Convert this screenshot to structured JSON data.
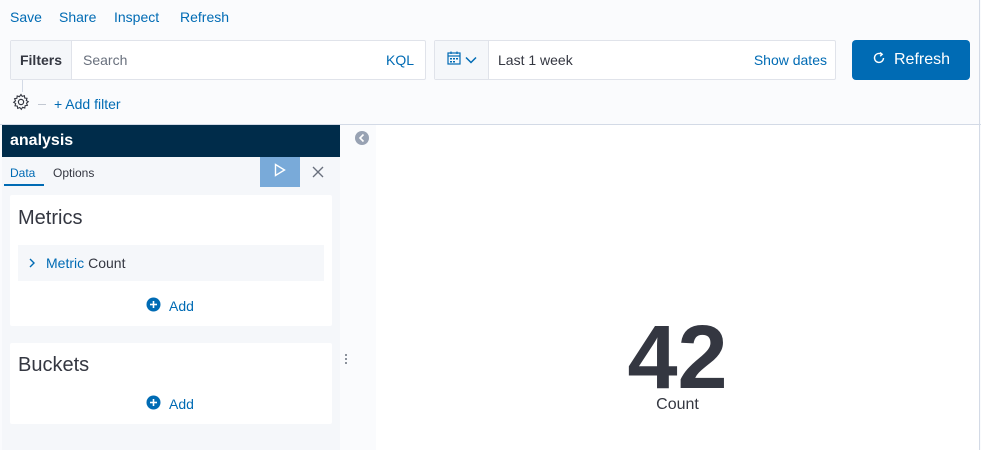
{
  "top_menu": {
    "save": "Save",
    "share": "Share",
    "inspect": "Inspect",
    "refresh": "Refresh"
  },
  "query_bar": {
    "filters_label": "Filters",
    "search_placeholder": "Search",
    "language": "KQL"
  },
  "date_picker": {
    "icon": "calendar-icon",
    "range": "Last 1 week",
    "show_dates": "Show dates"
  },
  "refresh_button": {
    "label": "Refresh",
    "icon": "refresh-icon"
  },
  "filter_bar": {
    "add_filter": "+ Add filter"
  },
  "sidebar": {
    "title": "analysis",
    "tabs": [
      {
        "label": "Data",
        "active": true
      },
      {
        "label": "Options",
        "active": false
      }
    ],
    "metrics": {
      "title": "Metrics",
      "items": [
        {
          "prefix": "Metric",
          "label": "Count"
        }
      ],
      "add_label": "Add"
    },
    "buckets": {
      "title": "Buckets",
      "add_label": "Add"
    }
  },
  "visualization": {
    "value": "42",
    "label": "Count"
  },
  "colors": {
    "primary": "#006bb4",
    "header": "#002c4a",
    "apply_disabled": "#79aad9",
    "text": "#343741"
  }
}
